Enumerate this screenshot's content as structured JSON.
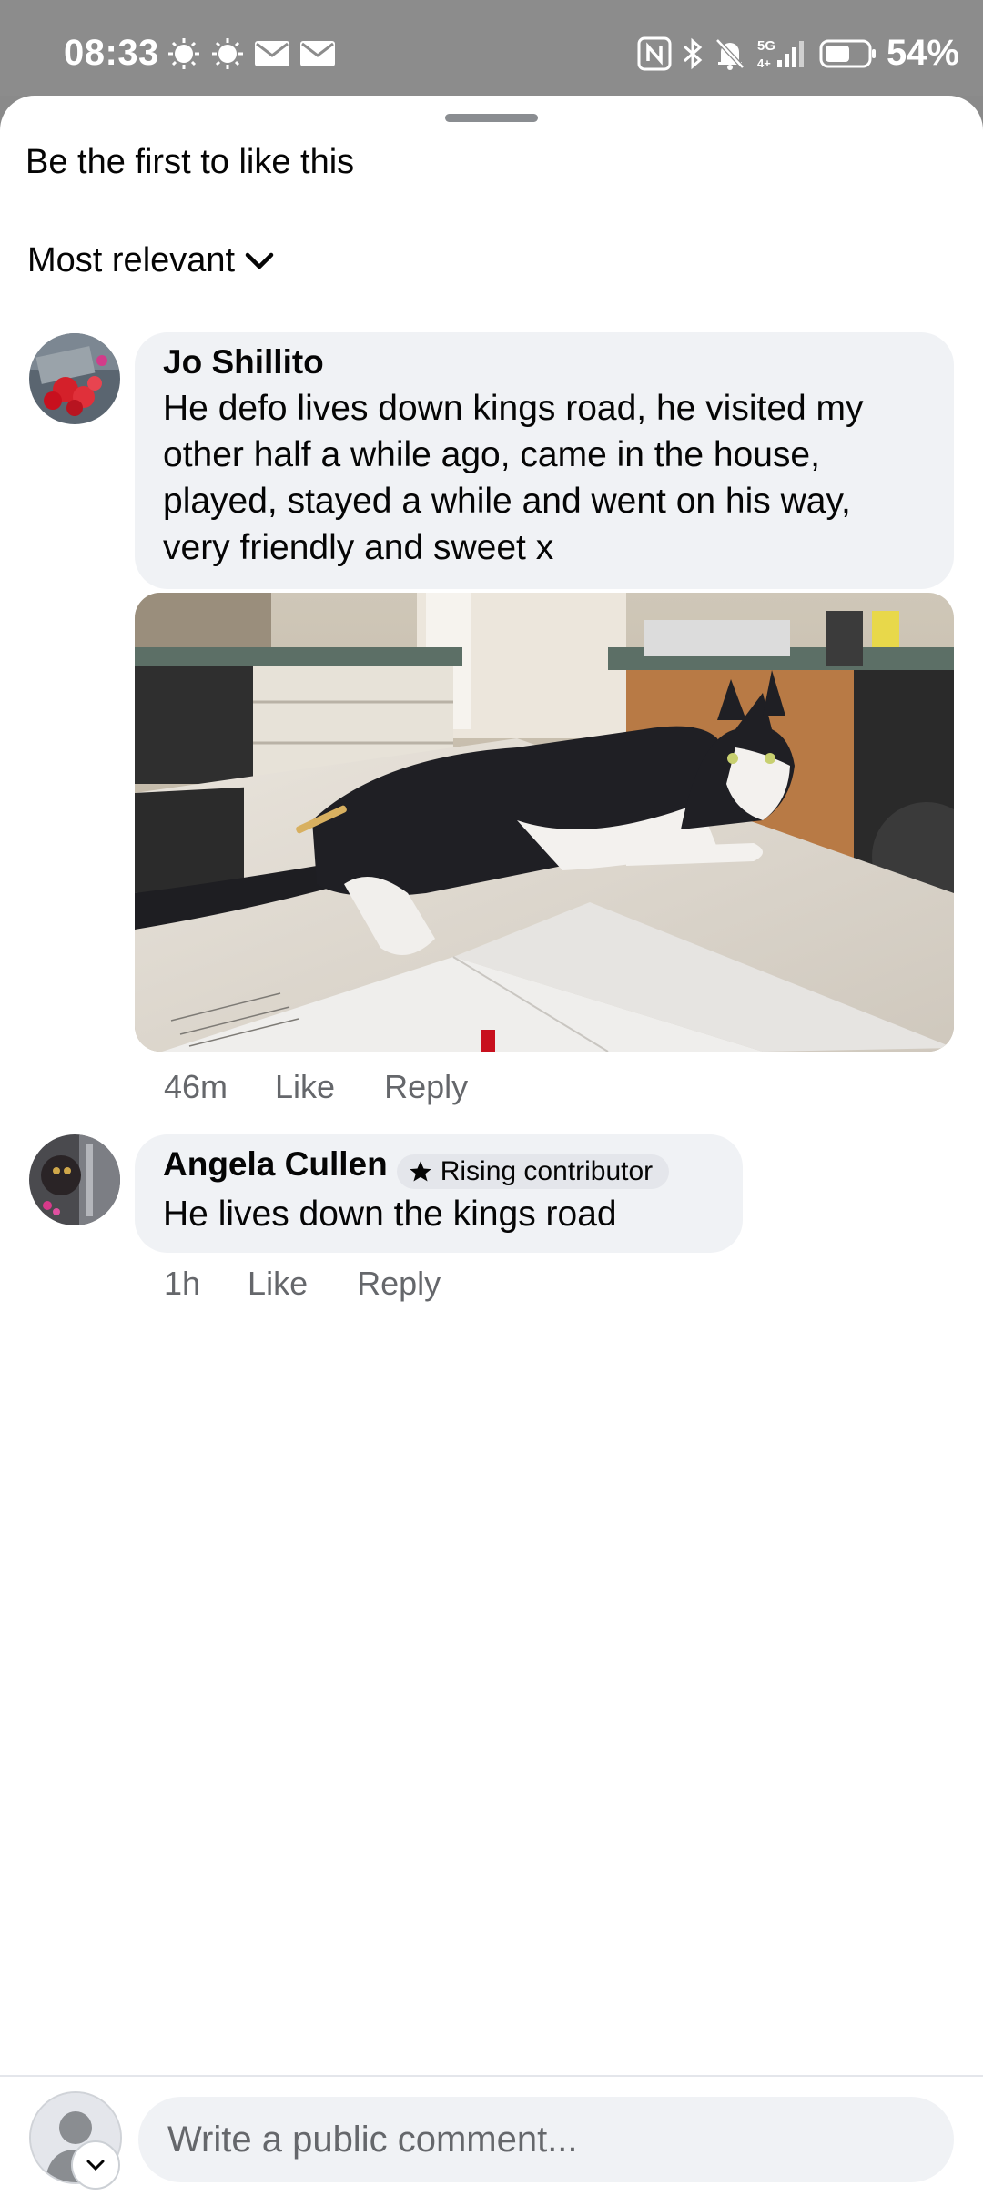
{
  "status_bar": {
    "time": "08:33",
    "battery_percent": "54%",
    "network_label": "5G"
  },
  "sheet": {
    "likes_text": "Be the first to like this",
    "sort_label": "Most relevant"
  },
  "comments": [
    {
      "author": "Jo Shillito",
      "text": "He defo lives down kings road, he visited my other half a while ago, came in the house, played, stayed a while and went on his way, very friendly and sweet x",
      "time": "46m",
      "like_label": "Like",
      "reply_label": "Reply",
      "has_photo": true
    },
    {
      "author": "Angela Cullen",
      "badge": "Rising contributor",
      "text": "He lives down the kings road",
      "time": "1h",
      "like_label": "Like",
      "reply_label": "Reply"
    }
  ],
  "composer": {
    "placeholder": "Write a public comment..."
  },
  "colors": {
    "bubble": "#f0f2f5",
    "meta_text": "#65676b",
    "status_bar": "#8c8c8c"
  }
}
